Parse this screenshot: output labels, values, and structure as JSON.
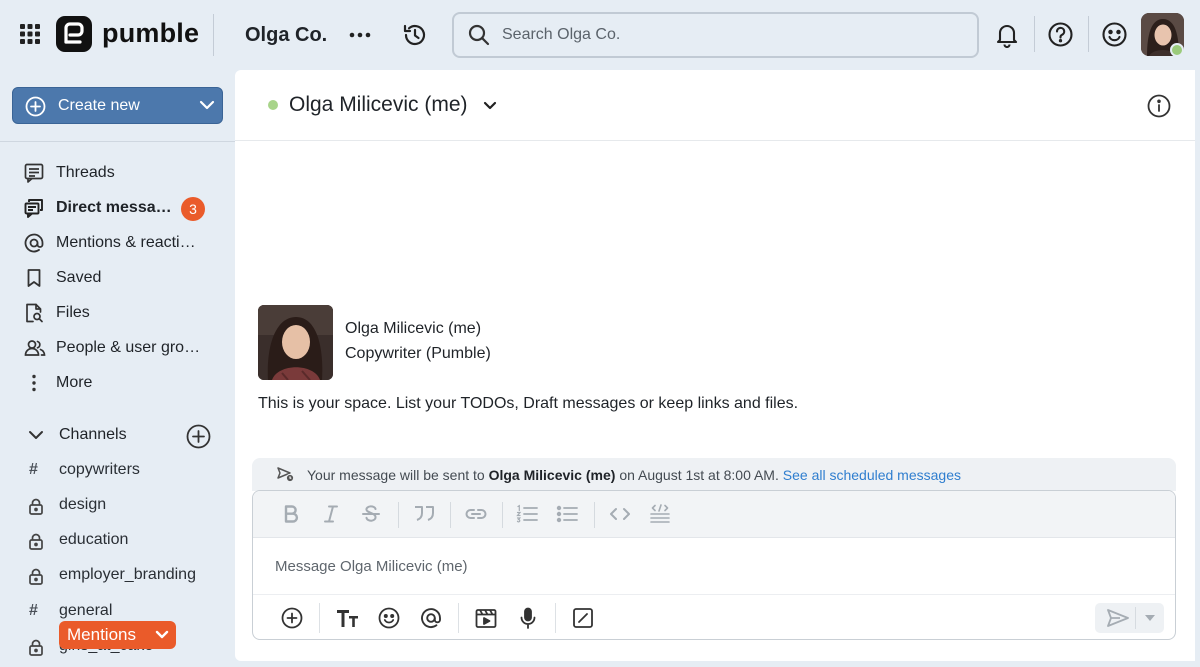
{
  "topbar": {
    "logo_text": "pumble",
    "workspace_name": "Olga Co.",
    "search_placeholder": "Search Olga Co."
  },
  "sidebar": {
    "create_label": "Create new",
    "items": [
      {
        "label": "Threads",
        "icon": "threads-icon"
      },
      {
        "label": "Direct messages",
        "icon": "direct-messages-icon",
        "badge": "3"
      },
      {
        "label": "Mentions & reactions",
        "icon": "at-icon"
      },
      {
        "label": "Saved",
        "icon": "bookmark-icon"
      },
      {
        "label": "Files",
        "icon": "file-search-icon"
      },
      {
        "label": "People & user groups",
        "icon": "people-icon"
      },
      {
        "label": "More",
        "icon": "kebab-icon"
      }
    ],
    "channels_label": "Channels",
    "channels": [
      {
        "name": "copywriters",
        "type": "public"
      },
      {
        "name": "design",
        "type": "private"
      },
      {
        "name": "education",
        "type": "private"
      },
      {
        "name": "employer_branding",
        "type": "private"
      },
      {
        "name": "general",
        "type": "public"
      },
      {
        "name": "girls_at_cake",
        "type": "private"
      }
    ],
    "mentions_label": "Mentions"
  },
  "main": {
    "title": "Olga Milicevic (me)",
    "intro": {
      "name": "Olga Milicevic (me)",
      "role": "Copywriter (Pumble)",
      "text": "This is your space. List your TODOs, Draft messages or keep links and files."
    },
    "scheduled": {
      "prefix": "Your message will be sent to",
      "recipient": "Olga Milicevic (me)",
      "when": "on August 1st at 8:00 AM.",
      "link": "See all scheduled messages"
    },
    "composer": {
      "placeholder": "Message Olga Milicevic (me)"
    }
  },
  "colors": {
    "accent": "#4c78ac",
    "badge": "#ea5b2a",
    "presence": "#9bcb7b",
    "link": "#2f7ecf"
  }
}
